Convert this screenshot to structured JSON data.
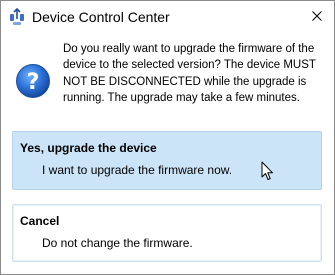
{
  "window": {
    "title": "Device Control Center",
    "app_icon": "device-app-icon",
    "close_icon": "close-icon"
  },
  "dialog": {
    "icon": "question-icon",
    "message": "Do you really want to upgrade the firmware of the device to the selected version? The device MUST NOT BE DISCONNECTED while the upgrade is running. The upgrade may take a few minutes."
  },
  "options": [
    {
      "title": "Yes, upgrade the device",
      "description": "I want to upgrade the firmware now."
    },
    {
      "title": "Cancel",
      "description": "Do not change the firmware."
    }
  ],
  "colors": {
    "primary_option_bg": "#cce4f7",
    "primary_option_border": "#b3d3f0",
    "question_icon_blue": "#2a6fd6"
  }
}
